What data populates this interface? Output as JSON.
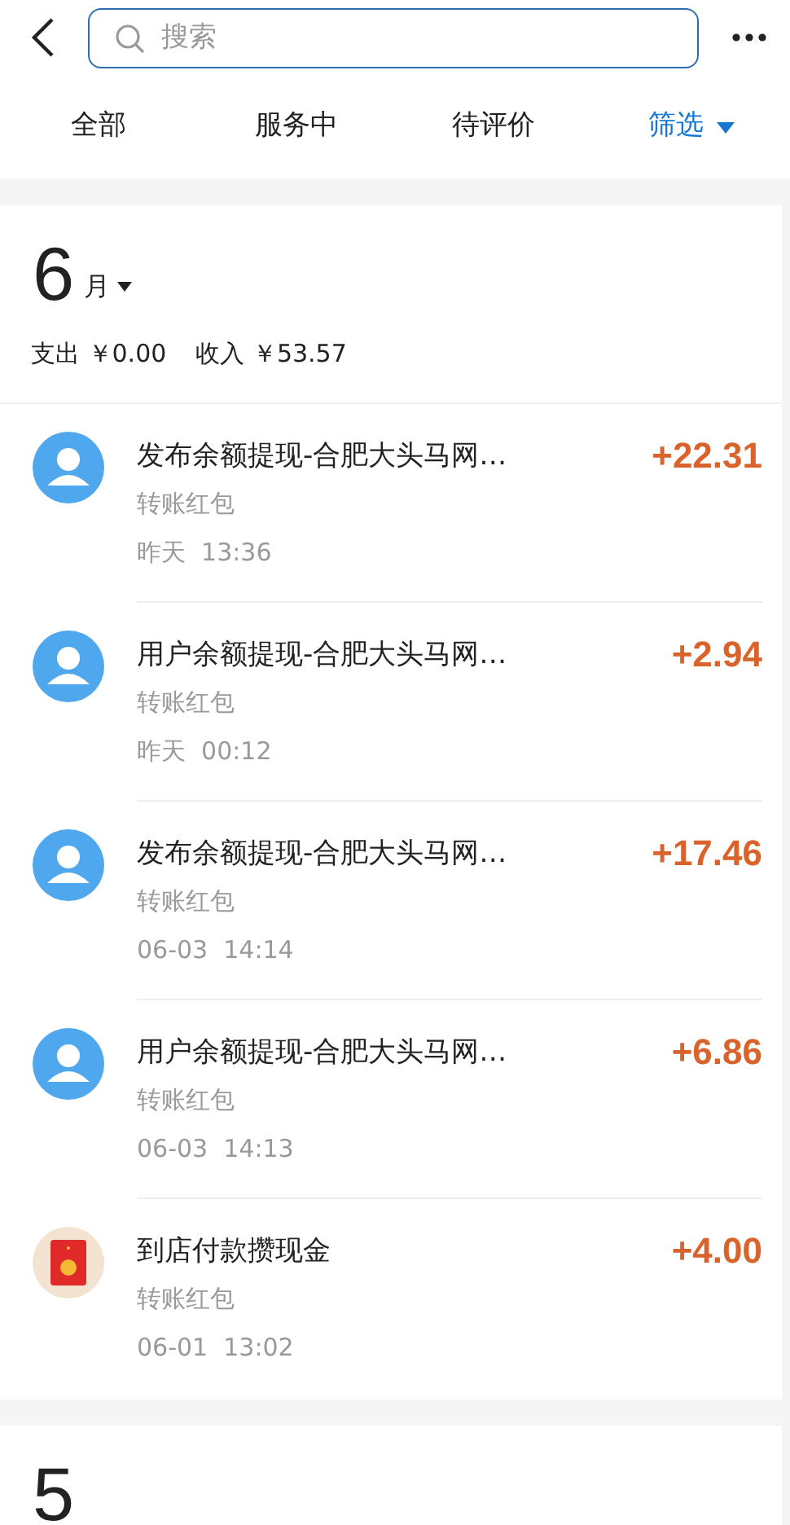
{
  "search": {
    "placeholder": "搜索"
  },
  "tabs": [
    "全部",
    "服务中",
    "待评价"
  ],
  "filter": {
    "label": "筛选"
  },
  "months": [
    {
      "month": "6",
      "unit": "月",
      "expense": "支出 ￥0.00",
      "income": "收入 ￥53.57",
      "records": [
        {
          "kind": "user",
          "title": "发布余额提现-合肥大头马网…",
          "amount": "+22.31",
          "type": "转账红包",
          "time": "昨天  13:36"
        },
        {
          "kind": "user",
          "title": "用户余额提现-合肥大头马网…",
          "amount": "+2.94",
          "type": "转账红包",
          "time": "昨天  00:12"
        },
        {
          "kind": "user",
          "title": "发布余额提现-合肥大头马网…",
          "amount": "+17.46",
          "type": "转账红包",
          "time": "06-03  14:14"
        },
        {
          "kind": "user",
          "title": "用户余额提现-合肥大头马网…",
          "amount": "+6.86",
          "type": "转账红包",
          "time": "06-03  14:13"
        },
        {
          "kind": "red_packet",
          "title": "到店付款攒现金",
          "amount": "+4.00",
          "type": "转账红包",
          "time": "06-01  13:02"
        }
      ]
    },
    {
      "month": "5"
    }
  ]
}
